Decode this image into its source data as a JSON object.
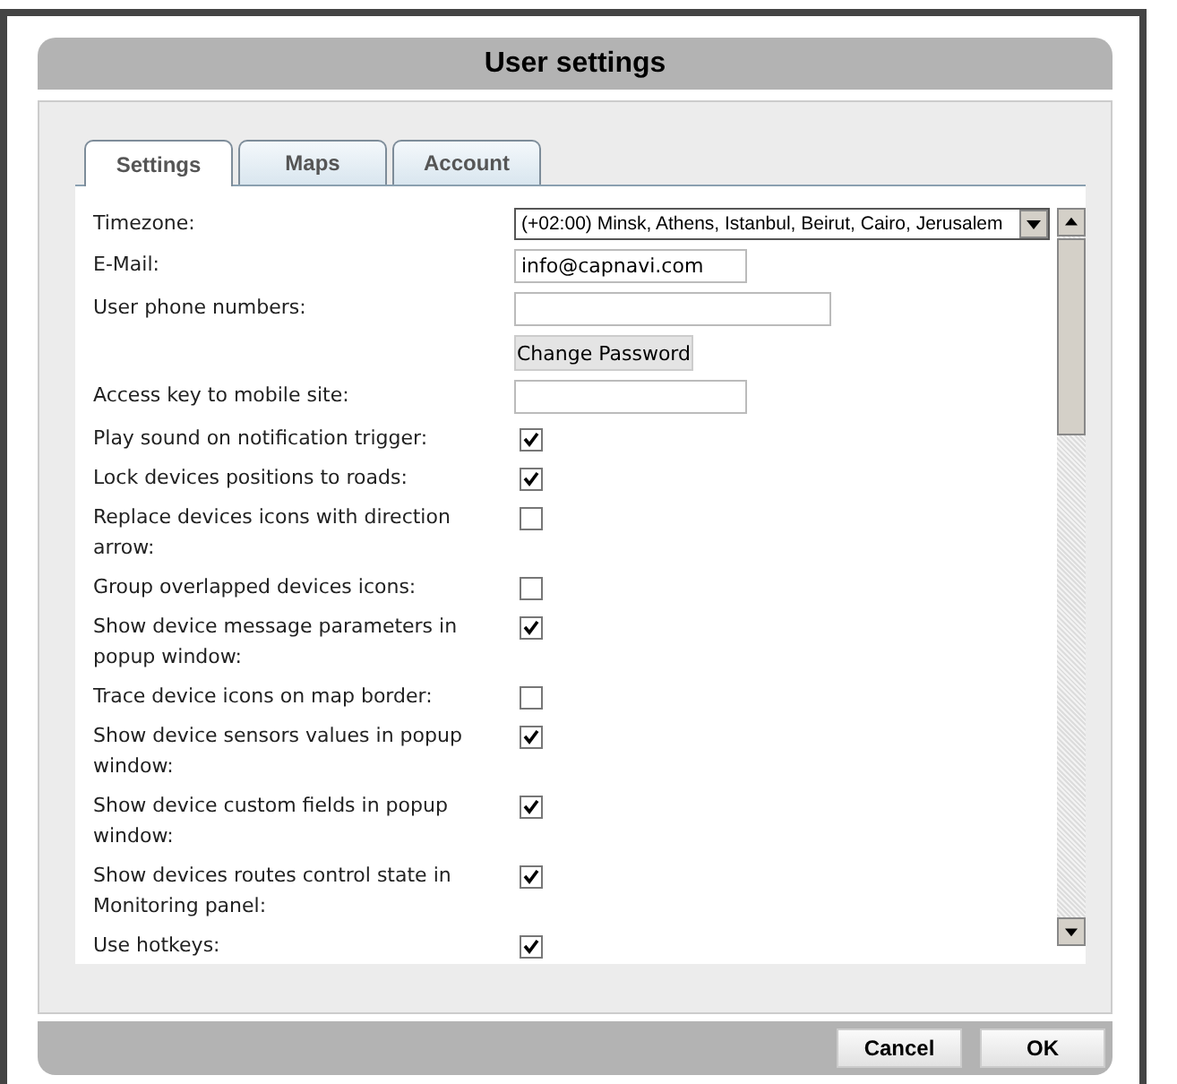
{
  "dialog": {
    "title": "User settings"
  },
  "tabs": [
    {
      "label": "Settings",
      "selected": true
    },
    {
      "label": "Maps",
      "selected": false
    },
    {
      "label": "Account",
      "selected": false
    }
  ],
  "rows": [
    {
      "kind": "select",
      "label": "Timezone:",
      "value": "(+02:00) Minsk, Athens, Istanbul, Beirut, Cairo, Jerusalem"
    },
    {
      "kind": "text",
      "label": "E-Mail:",
      "value": "info@capnavi.com",
      "wide": false
    },
    {
      "kind": "text",
      "label": "User phone numbers:",
      "value": "",
      "wide": true
    },
    {
      "kind": "button",
      "text": "Change Password"
    },
    {
      "kind": "text",
      "label": "Access key to mobile site:",
      "value": "",
      "wide": false
    },
    {
      "kind": "checkbox",
      "label": "Play sound on notification trigger:",
      "checked": true
    },
    {
      "kind": "checkbox",
      "label": "Lock devices positions to roads:",
      "checked": true
    },
    {
      "kind": "checkbox",
      "label": "Replace devices icons with direction arrow:",
      "checked": false
    },
    {
      "kind": "checkbox",
      "label": "Group overlapped devices icons:",
      "checked": false
    },
    {
      "kind": "checkbox",
      "label": "Show device message parameters in popup window:",
      "checked": true
    },
    {
      "kind": "checkbox",
      "label": "Trace device icons on map border:",
      "checked": false
    },
    {
      "kind": "checkbox",
      "label": "Show device sensors values in popup window:",
      "checked": true
    },
    {
      "kind": "checkbox",
      "label": "Show device custom fields in popup window:",
      "checked": true
    },
    {
      "kind": "checkbox",
      "label": "Show devices routes control state in Monitoring panel:",
      "checked": true
    },
    {
      "kind": "checkbox",
      "label": "Use hotkeys:",
      "checked": true
    }
  ],
  "buttons": [
    {
      "label": "Cancel"
    },
    {
      "label": "OK"
    }
  ]
}
